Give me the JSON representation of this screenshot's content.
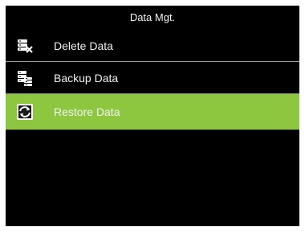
{
  "header": {
    "title": "Data Mgt."
  },
  "menu": {
    "items": [
      {
        "label": "Delete Data",
        "icon": "database-delete-icon",
        "selected": false
      },
      {
        "label": "Backup Data",
        "icon": "database-backup-icon",
        "selected": false
      },
      {
        "label": "Restore Data",
        "icon": "database-restore-icon",
        "selected": true
      }
    ]
  },
  "colors": {
    "background": "#000000",
    "text": "#f2f2f2",
    "selected_background": "#8dc63f",
    "divider": "#9a9a9a"
  }
}
